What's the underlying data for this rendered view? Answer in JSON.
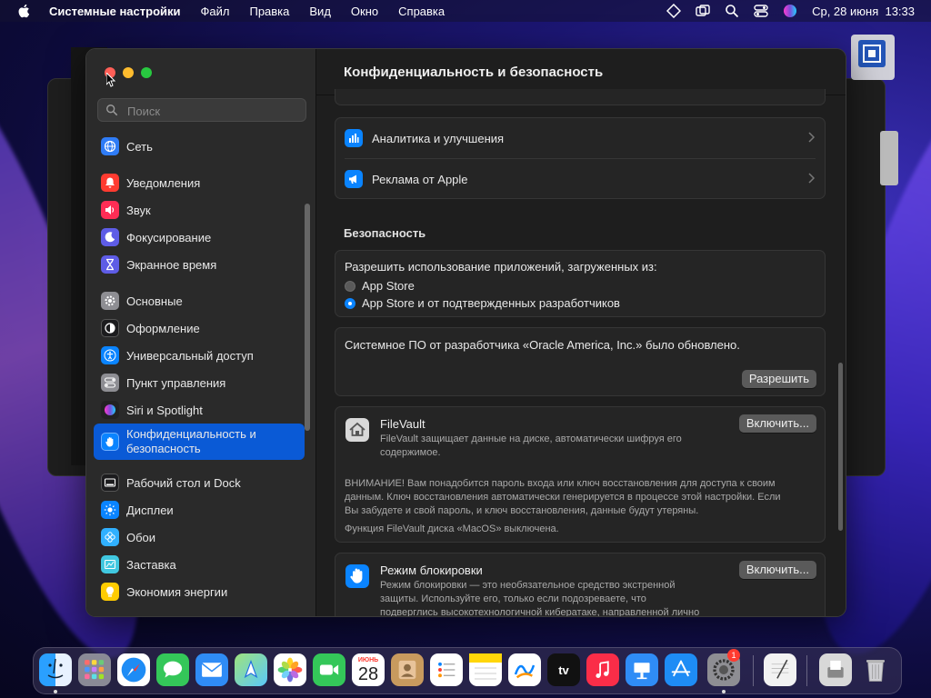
{
  "menubar": {
    "app_name": "Системные настройки",
    "items": [
      "Файл",
      "Правка",
      "Вид",
      "Окно",
      "Справка"
    ],
    "clock": "Ср, 28 июня  13:33"
  },
  "sidebar": {
    "search_placeholder": "Поиск",
    "items": [
      {
        "label": "Сеть",
        "icon": "globe-icon",
        "color": "#2f7cf6"
      },
      {
        "label": "Уведомления",
        "icon": "bell-icon",
        "color": "#ff3b30"
      },
      {
        "label": "Звук",
        "icon": "speaker-icon",
        "color": "#ff2d55"
      },
      {
        "label": "Фокусирование",
        "icon": "moon-icon",
        "color": "#5e5ce6"
      },
      {
        "label": "Экранное время",
        "icon": "hourglass-icon",
        "color": "#5e5ce6"
      },
      {
        "label": "Основные",
        "icon": "gear-icon",
        "color": "#8e8e93"
      },
      {
        "label": "Оформление",
        "icon": "appearance-icon",
        "color": "#1c1c1e"
      },
      {
        "label": "Универсальный доступ",
        "icon": "accessibility-icon",
        "color": "#0a84ff"
      },
      {
        "label": "Пункт управления",
        "icon": "control-center-icon",
        "color": "#8e8e93"
      },
      {
        "label": "Siri и Spotlight",
        "icon": "siri-icon",
        "color": "#7d4cdb"
      },
      {
        "label": "Конфиденциальность и\nбезопасность",
        "icon": "hand-icon",
        "color": "#0a84ff"
      },
      {
        "label": "Рабочий стол и Dock",
        "icon": "dock-icon",
        "color": "#1c1c1e"
      },
      {
        "label": "Дисплеи",
        "icon": "sun-icon",
        "color": "#0a84ff"
      },
      {
        "label": "Обои",
        "icon": "flower-icon",
        "color": "#30b0ff"
      },
      {
        "label": "Заставка",
        "icon": "screensaver-icon",
        "color": "#40c8e0"
      },
      {
        "label": "Экономия энергии",
        "icon": "bulb-icon",
        "color": "#ffcc00"
      }
    ],
    "selected_index": 10
  },
  "content": {
    "title": "Конфиденциальность и безопасность",
    "privacy_rows": [
      {
        "label": "Аналитика и улучшения",
        "icon": "chart-icon"
      },
      {
        "label": "Реклама от Apple",
        "icon": "megaphone-icon"
      }
    ],
    "security_heading": "Безопасность",
    "allow_apps": {
      "label": "Разрешить использование приложений, загруженных из:",
      "options": [
        "App Store",
        "App Store и от подтвержденных разработчиков"
      ],
      "selected": 1
    },
    "system_sw": {
      "text": "Системное ПО от разработчика «Oracle America, Inc.» было обновлено.",
      "button": "Разрешить"
    },
    "filevault": {
      "title": "FileVault",
      "desc1": "FileVault защищает данные на диске, автоматически шифруя его",
      "desc2": "содержимое.",
      "button": "Включить...",
      "warn1": "ВНИМАНИЕ! Вам понадобится пароль входа или ключ восстановления для доступа к своим",
      "warn2": "данным. Ключ восстановления автоматически генерируется в процессе этой настройки. Если",
      "warn3": "Вы забудете и свой пароль, и ключ восстановления, данные будут утеряны.",
      "status": "Функция FileVault диска «MacOS» выключена."
    },
    "lockdown": {
      "title": "Режим блокировки",
      "desc1": "Режим блокировки — это необязательное средство экстренной",
      "desc2": "защиты. Используйте его, только если подозреваете, что",
      "desc3": "подверглись высокотехнологичной кибератаке, направленной лично",
      "button": "Включить..."
    }
  },
  "dock": {
    "calendar_month": "ИЮНЬ",
    "calendar_day": "28",
    "appletv_label": "tv",
    "settings_badge": "1"
  }
}
